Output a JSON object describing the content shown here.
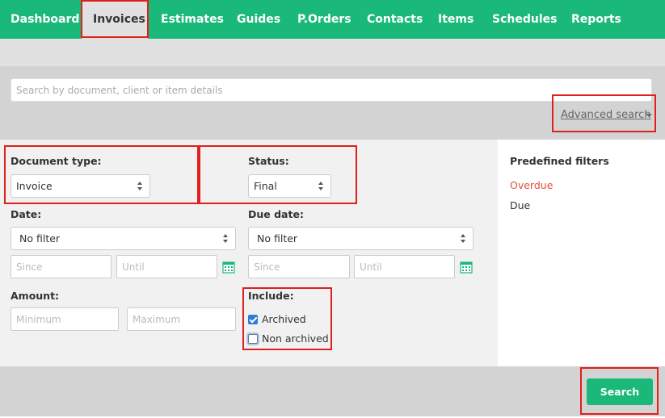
{
  "nav": {
    "items": [
      {
        "label": "Dashboard"
      },
      {
        "label": "Invoices"
      },
      {
        "label": "Estimates"
      },
      {
        "label": "Guides"
      },
      {
        "label": "P.Orders"
      },
      {
        "label": "Contacts"
      },
      {
        "label": "Items"
      },
      {
        "label": "Schedules"
      },
      {
        "label": "Reports"
      }
    ],
    "active": "Invoices"
  },
  "search": {
    "placeholder": "Search by document, client or item details",
    "advanced_label": "Advanced search"
  },
  "filters": {
    "document_type": {
      "label": "Document type:",
      "value": "Invoice"
    },
    "status": {
      "label": "Status:",
      "value": "Final"
    },
    "date": {
      "label": "Date:",
      "value": "No filter",
      "since_placeholder": "Since",
      "until_placeholder": "Until"
    },
    "due_date": {
      "label": "Due date:",
      "value": "No filter",
      "since_placeholder": "Since",
      "until_placeholder": "Until"
    },
    "amount": {
      "label": "Amount:",
      "min_placeholder": "Minimum",
      "max_placeholder": "Maximum"
    },
    "include": {
      "label": "Include:",
      "options": [
        {
          "label": "Archived",
          "checked": true
        },
        {
          "label": "Non archived",
          "checked": false
        }
      ]
    }
  },
  "predefined": {
    "title": "Predefined filters",
    "items": [
      {
        "label": "Overdue",
        "color": "#e0503a"
      },
      {
        "label": "Due",
        "color": "#333333"
      }
    ]
  },
  "actions": {
    "search_label": "Search"
  },
  "colors": {
    "brand": "#1ab97a",
    "highlight": "#e0201b"
  }
}
